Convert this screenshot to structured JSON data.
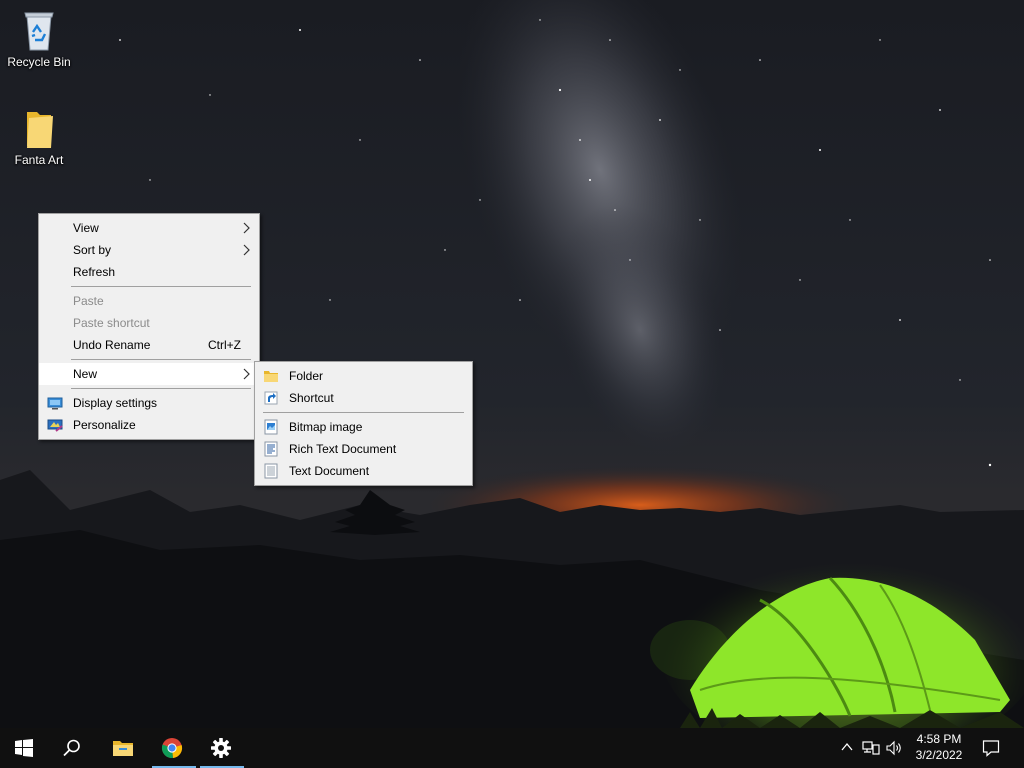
{
  "desktop": {
    "icons": [
      {
        "label": "Recycle Bin",
        "icon": "recycle-bin-icon"
      },
      {
        "label": "Fanta Art",
        "icon": "folder-icon"
      }
    ]
  },
  "context_menu": {
    "items": {
      "view": "View",
      "sort_by": "Sort by",
      "refresh": "Refresh",
      "paste": "Paste",
      "paste_shortcut": "Paste shortcut",
      "undo_rename": "Undo Rename",
      "undo_rename_shortcut": "Ctrl+Z",
      "new": "New",
      "display_settings": "Display settings",
      "personalize": "Personalize"
    }
  },
  "new_submenu": {
    "items": {
      "folder": "Folder",
      "shortcut": "Shortcut",
      "bitmap": "Bitmap image",
      "rich_text": "Rich Text Document",
      "text_document": "Text Document"
    }
  },
  "taskbar": {
    "pinned": [
      "start-icon",
      "search-icon",
      "file-explorer-icon",
      "chrome-icon",
      "settings-icon"
    ],
    "clock": {
      "time": "4:58 PM",
      "date": "3/2/2022"
    }
  },
  "colors": {
    "menu_bg": "#f0f0f0",
    "taskbar_bg": "#101010",
    "active_indicator": "#76b9ed",
    "tent_green": "#8ee62a"
  }
}
